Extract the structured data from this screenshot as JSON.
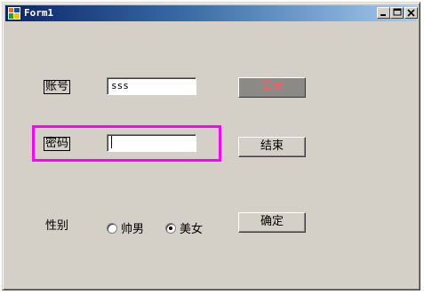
{
  "window": {
    "title": "Form1"
  },
  "form": {
    "account_label": "账号",
    "account_value": "sss",
    "password_label": "密码",
    "password_value": "",
    "gender_label": "性别",
    "gender_options": [
      {
        "label": "帅男",
        "checked": false
      },
      {
        "label": "美女",
        "checked": true
      }
    ],
    "display_button": "显示",
    "end_button": "结束",
    "confirm_button": "确定"
  },
  "colors": {
    "highlight_border": "#ff00ff",
    "display_button_text": "#ff5a5a",
    "window_bg": "#d4d0c8"
  },
  "icons": [
    "app-icon",
    "minimize-icon",
    "maximize-icon",
    "close-icon"
  ]
}
